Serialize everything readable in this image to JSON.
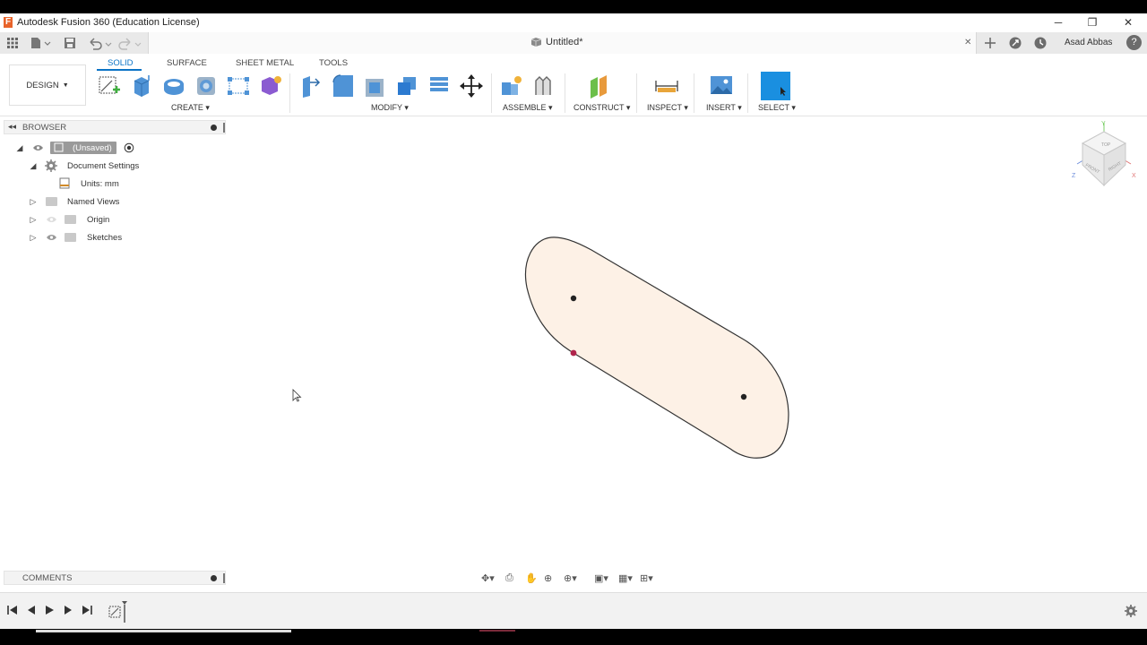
{
  "window": {
    "app_title": "Autodesk Fusion 360 (Education License)",
    "app_icon_letter": "F",
    "minimize": "─",
    "restore": "❐",
    "close": "✕"
  },
  "quick": {
    "doc_title": "Untitled*",
    "doc_close": "✕",
    "user_name": "Asad Abbas",
    "help": "?"
  },
  "ribbon": {
    "workspace_label": "DESIGN",
    "tabs": [
      "SOLID",
      "SURFACE",
      "SHEET METAL",
      "TOOLS"
    ],
    "groups": [
      "CREATE",
      "MODIFY",
      "ASSEMBLE",
      "CONSTRUCT",
      "INSPECT",
      "INSERT",
      "SELECT"
    ]
  },
  "browser": {
    "header": "BROWSER",
    "root": "(Unsaved)",
    "nodes": {
      "document_settings": "Document Settings",
      "units": "Units: mm",
      "named_views": "Named Views",
      "origin": "Origin",
      "sketches": "Sketches"
    }
  },
  "comments": {
    "header": "COMMENTS"
  },
  "viewcube": {
    "top": "TOP",
    "front": "FRONT",
    "right": "RIGHT",
    "axis_y": "Y",
    "axis_x": "X",
    "axis_z": "Z"
  },
  "colors": {
    "accent": "#0a73c6",
    "sketch_fill": "#fdf1e6",
    "sketch_point": "#b0244c",
    "select_tile": "#1a8fe0"
  },
  "icons": {
    "grid": "grid-icon",
    "file": "file-icon",
    "save": "save-icon",
    "undo": "undo-icon",
    "redo": "redo-icon",
    "timeline_settings": "gear-icon"
  }
}
